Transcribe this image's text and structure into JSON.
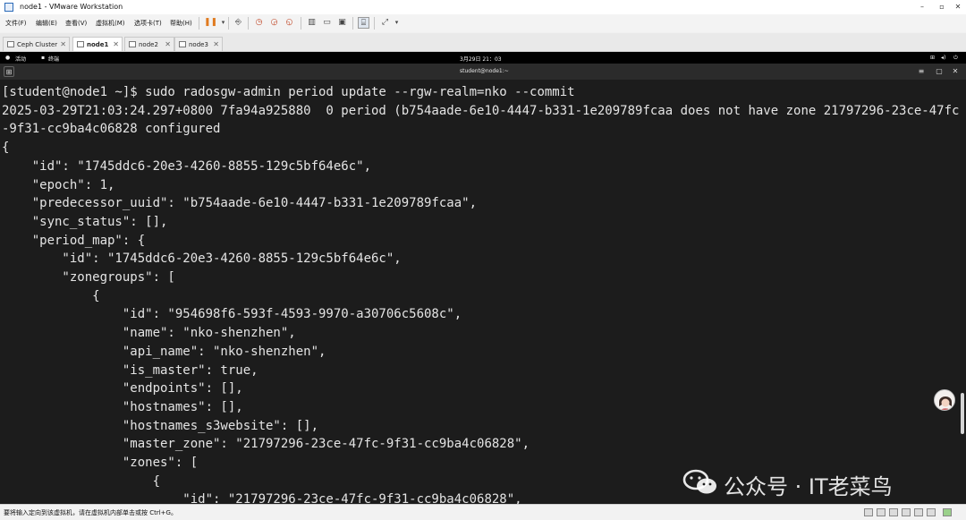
{
  "window": {
    "title": "node1 - VMware Workstation"
  },
  "menu": {
    "items": [
      "文件(F)",
      "编辑(E)",
      "查看(V)",
      "虚拟机(M)",
      "选项卡(T)",
      "帮助(H)"
    ],
    "pause_color": "#e07a1f"
  },
  "tabs": [
    {
      "label": "Ceph Cluster",
      "active": false
    },
    {
      "label": "node1",
      "active": true
    },
    {
      "label": "node2",
      "active": false
    },
    {
      "label": "node3",
      "active": false
    }
  ],
  "gnome": {
    "activities": "活动",
    "terminal": "终端",
    "clock": "3月29日 21：03"
  },
  "terminal": {
    "title": "student@node1:~",
    "lines": [
      "[student@node1 ~]$ sudo radosgw-admin period update --rgw-realm=nko --commit",
      "2025-03-29T21:03:24.297+0800 7fa94a925880  0 period (b754aade-6e10-4447-b331-1e209789fcaa does not have zone 21797296-23ce-47fc",
      "-9f31-cc9ba4c06828 configured",
      "{",
      "    \"id\": \"1745ddc6-20e3-4260-8855-129c5bf64e6c\",",
      "    \"epoch\": 1,",
      "    \"predecessor_uuid\": \"b754aade-6e10-4447-b331-1e209789fcaa\",",
      "    \"sync_status\": [],",
      "    \"period_map\": {",
      "        \"id\": \"1745ddc6-20e3-4260-8855-129c5bf64e6c\",",
      "        \"zonegroups\": [",
      "            {",
      "                \"id\": \"954698f6-593f-4593-9970-a30706c5608c\",",
      "                \"name\": \"nko-shenzhen\",",
      "                \"api_name\": \"nko-shenzhen\",",
      "                \"is_master\": true,",
      "                \"endpoints\": [],",
      "                \"hostnames\": [],",
      "                \"hostnames_s3website\": [],",
      "                \"master_zone\": \"21797296-23ce-47fc-9f31-cc9ba4c06828\",",
      "                \"zones\": [",
      "                    {",
      "                        \"id\": \"21797296-23ce-47fc-9f31-cc9ba4c06828\","
    ]
  },
  "watermark": {
    "text": "公众号 · IT老菜鸟"
  },
  "status": {
    "text": "要将输入定向到该虚拟机，请在虚拟机内部单击或按 Ctrl+G。"
  }
}
